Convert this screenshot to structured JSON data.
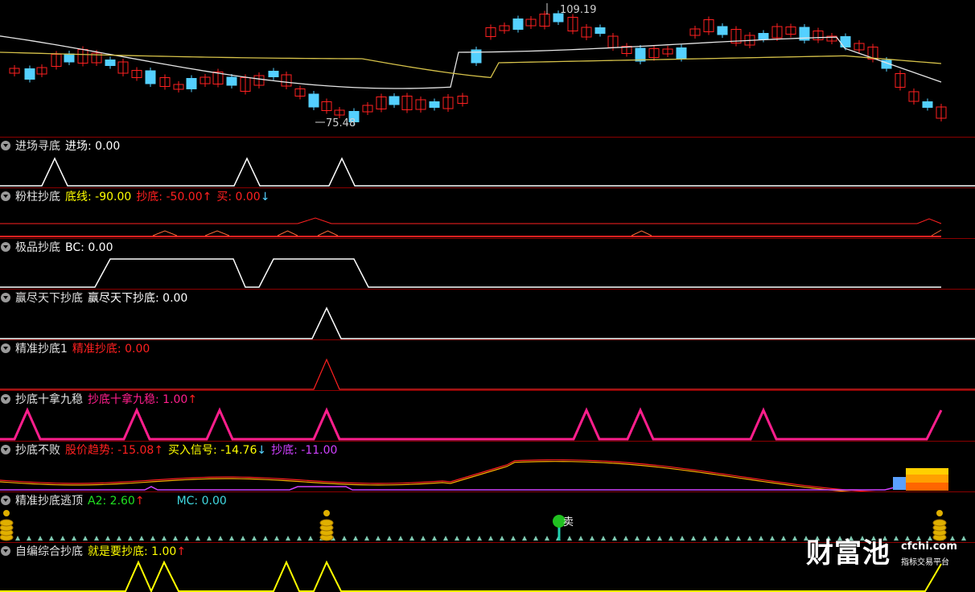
{
  "price": {
    "high_label": "109.19",
    "low_label": "75.48"
  },
  "panels": [
    {
      "name": "进场寻底",
      "values": [
        {
          "label": "进场:",
          "value": "0.00",
          "color": "#ffffff",
          "arrow": ""
        }
      ]
    },
    {
      "name": "粉柱抄底",
      "values": [
        {
          "label": "底线:",
          "value": "-90.00",
          "color": "#ffff00",
          "arrow": ""
        },
        {
          "label": "抄底:",
          "value": "-50.00",
          "color": "#ff2020",
          "arrow": "↑"
        },
        {
          "label": "买:",
          "value": "0.00",
          "color": "#ff2020",
          "arrow": "↓"
        }
      ]
    },
    {
      "name": "极品抄底",
      "values": [
        {
          "label": "BC:",
          "value": "0.00",
          "color": "#ffffff",
          "arrow": ""
        }
      ]
    },
    {
      "name": "赢尽天下抄底",
      "values": [
        {
          "label": "赢尽天下抄底:",
          "value": "0.00",
          "color": "#ffffff",
          "arrow": ""
        }
      ]
    },
    {
      "name": "精准抄底1",
      "values": [
        {
          "label": "精准抄底:",
          "value": "0.00",
          "color": "#ff2020",
          "arrow": ""
        }
      ]
    },
    {
      "name": "抄底十拿九稳",
      "values": [
        {
          "label": "抄底十拿九稳:",
          "value": "1.00",
          "color": "#ff1e8c",
          "arrow": "↑"
        }
      ]
    },
    {
      "name": "抄底不败",
      "values": [
        {
          "label": "股价趋势:",
          "value": "-15.08",
          "color": "#ff2020",
          "arrow": "↑"
        },
        {
          "label": "买入信号:",
          "value": "-14.76",
          "color": "#ffff00",
          "arrow": "↓"
        },
        {
          "label": "抄底:",
          "value": "-11.00",
          "color": "#d040ff",
          "arrow": ""
        }
      ]
    },
    {
      "name": "精准抄底逃顶",
      "values": [
        {
          "label": "A2:",
          "value": "2.60",
          "color": "#20e020",
          "arrow": "↑"
        },
        {
          "label": "MC:",
          "value": "0.00",
          "color": "#40d8e0",
          "arrow": ""
        }
      ]
    },
    {
      "name": "自编综合抄底",
      "values": [
        {
          "label": "就是要抄底:",
          "value": "1.00",
          "color": "#ffff00",
          "arrow": "↑"
        }
      ]
    }
  ],
  "sell_label": "卖",
  "watermark": {
    "brand": "财富池",
    "domain": "cfchi.com",
    "slogan": "指标交易平台"
  },
  "colors": {
    "up": "#ff2020",
    "down": "#54d0ff",
    "border": "#8b0000"
  }
}
